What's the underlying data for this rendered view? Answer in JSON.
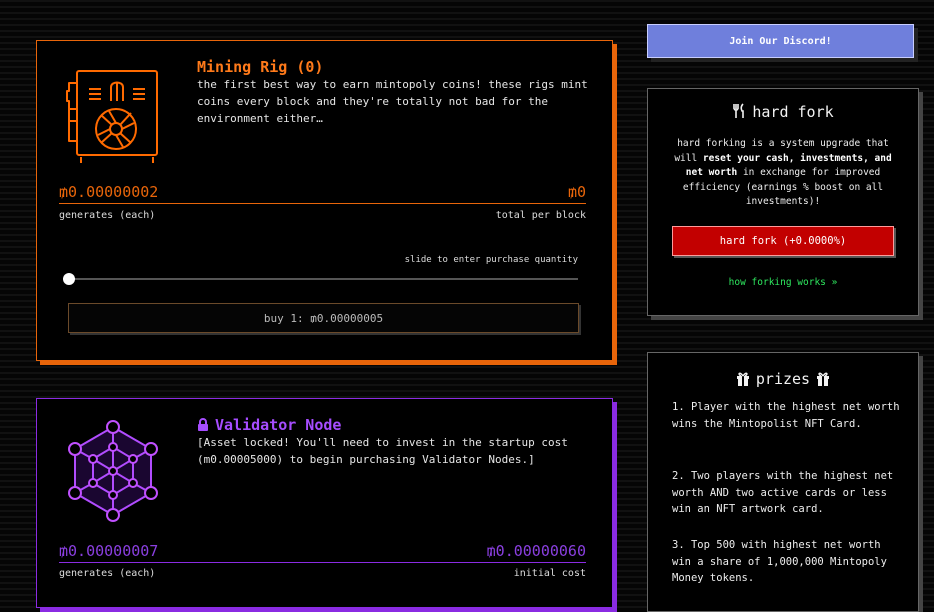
{
  "discord": {
    "label": "Join Our Discord!"
  },
  "mining_rig": {
    "title": "Mining Rig (0)",
    "description": "the first best way to earn mintopoly coins! these rigs mint coins every block and they're totally not bad for the environment either…",
    "generates_value": "₥0.00000002",
    "total_value": "₥0",
    "generates_label": "generates (each)",
    "total_label": "total per block",
    "slider_hint": "slide to enter purchase quantity",
    "slider_fraction": 0,
    "buy_label": "buy 1: ₥0.00000005",
    "accent": "#e8650a"
  },
  "validator_node": {
    "title": "Validator Node",
    "description": "[Asset locked! You'll need to invest in the startup cost (m0.00005000) to begin purchasing Validator Nodes.]",
    "generates_value": "₥0.00000007",
    "cost_value": "₥0.00000060",
    "generates_label": "generates (each)",
    "cost_label": "initial cost",
    "accent": "#8a2be2",
    "icon": "lock-icon"
  },
  "hard_fork": {
    "icon": "fork-knife-icon",
    "title": "hard fork",
    "text_1": "hard forking is a system upgrade that will ",
    "text_bold_1": "reset your cash, investments, and net worth",
    "text_2": " in exchange for improved efficiency (earnings % boost on all investments)!",
    "button_label": "hard fork (+0.0000%)",
    "link_label": "how forking works »",
    "accent": "#c20000"
  },
  "prizes": {
    "icon": "gift-icon",
    "title": "prizes",
    "items": [
      "1. Player with the highest net worth wins the Mintopolist NFT Card.",
      "2. Two players with the highest net worth AND two active cards or less win an NFT artwork card.",
      "3. Top 500 with highest net worth win a share of 1,000,000 Mintopoly Money tokens."
    ]
  }
}
